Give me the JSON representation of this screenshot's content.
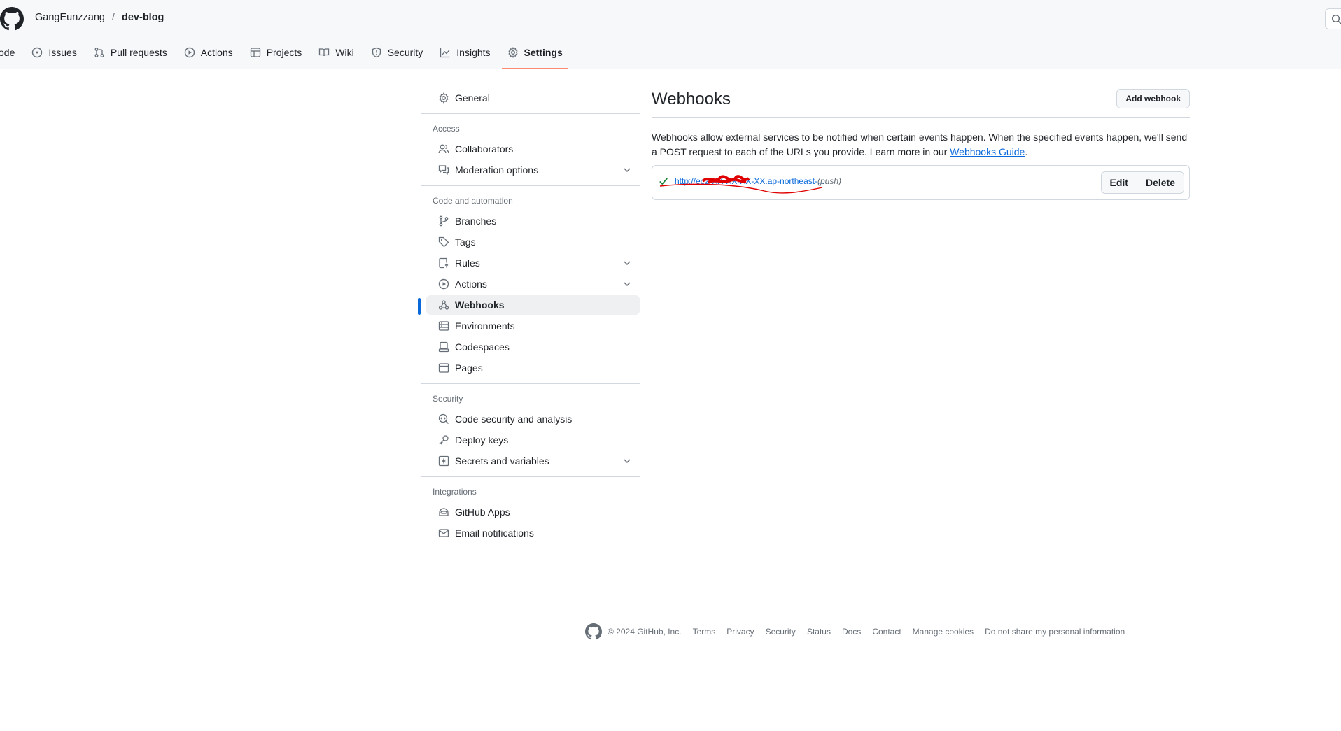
{
  "header": {
    "owner": "GangEunzzang",
    "separator": "/",
    "repo": "dev-blog"
  },
  "tabs": [
    {
      "label": "ode",
      "icon": "code-icon"
    },
    {
      "label": "Issues",
      "icon": "issue-opened-icon"
    },
    {
      "label": "Pull requests",
      "icon": "git-pull-request-icon"
    },
    {
      "label": "Actions",
      "icon": "play-icon"
    },
    {
      "label": "Projects",
      "icon": "table-icon"
    },
    {
      "label": "Wiki",
      "icon": "book-icon"
    },
    {
      "label": "Security",
      "icon": "shield-icon"
    },
    {
      "label": "Insights",
      "icon": "graph-icon"
    },
    {
      "label": "Settings",
      "icon": "gear-icon",
      "active": true
    }
  ],
  "sidebar": {
    "general": "General",
    "groups": {
      "access": "Access",
      "code_automation": "Code and automation",
      "security": "Security",
      "integrations": "Integrations"
    },
    "items": {
      "collaborators": "Collaborators",
      "moderation": "Moderation options",
      "branches": "Branches",
      "tags": "Tags",
      "rules": "Rules",
      "actions": "Actions",
      "webhooks": "Webhooks",
      "environments": "Environments",
      "codespaces": "Codespaces",
      "pages": "Pages",
      "code_security": "Code security and analysis",
      "deploy_keys": "Deploy keys",
      "secrets": "Secrets and variables",
      "github_apps": "GitHub Apps",
      "email_notifications": "Email notifications"
    }
  },
  "main": {
    "title": "Webhooks",
    "add_button": "Add webhook",
    "description_1": "Webhooks allow external services to be notified when certain events happen. When the specified events happen, we'll send a POST request to each of the URLs you provide. Learn more in our ",
    "guide_link": "Webhooks Guide",
    "description_end": ".",
    "webhook": {
      "url": "http://ec2-XX-XX-XX-XX.ap-northeast-...",
      "event": "(push)",
      "status": "success",
      "edit_label": "Edit",
      "delete_label": "Delete"
    }
  },
  "footer": {
    "copyright": "© 2024 GitHub, Inc.",
    "links": [
      "Terms",
      "Privacy",
      "Security",
      "Status",
      "Docs",
      "Contact",
      "Manage cookies",
      "Do not share my personal information"
    ]
  },
  "colors": {
    "accent": "#0969da",
    "active_tab_underline": "#fd8c73",
    "success": "#1a7f37",
    "scribble": "#e00000"
  }
}
